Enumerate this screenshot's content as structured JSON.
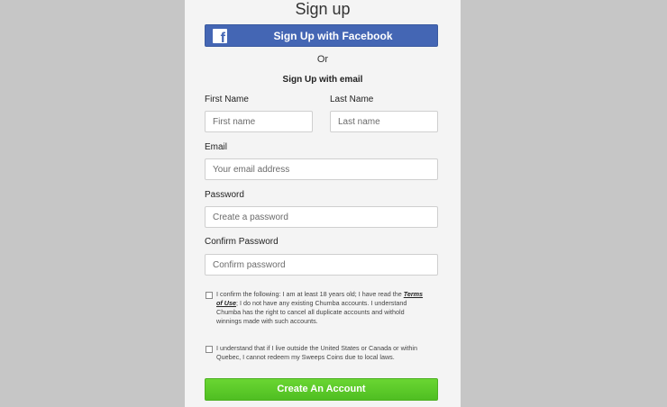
{
  "signup": {
    "title": "Sign up",
    "facebook_button": "Sign Up with Facebook",
    "facebook_icon": "f",
    "or_text": "Or",
    "email_heading": "Sign Up with email",
    "first_name": {
      "label": "First Name",
      "placeholder": "First name"
    },
    "last_name": {
      "label": "Last Name",
      "placeholder": "Last name"
    },
    "email": {
      "label": "Email",
      "placeholder": "Your email address"
    },
    "password": {
      "label": "Password",
      "placeholder": "Create a password"
    },
    "confirm_password": {
      "label": "Confirm Password",
      "placeholder": "Confirm password"
    },
    "terms_checkbox": {
      "text_before": "I confirm the following: I am at least 18 years old; I have read the ",
      "link": "Terms of Use",
      "text_after": "; I do not have any existing Chumba accounts. I understand Chumba has the right to cancel all duplicate accounts and withold winnings made with such accounts."
    },
    "location_checkbox": {
      "text": "I understand that if I live outside the United States or Canada or within Quebec, I cannot redeem my Sweeps Coins due to local laws."
    },
    "create_button": "Create An Account"
  },
  "colors": {
    "background": "#c6c6c6",
    "panel": "#f4f4f4",
    "facebook": "#4466b4",
    "create": "#5ac92a"
  }
}
